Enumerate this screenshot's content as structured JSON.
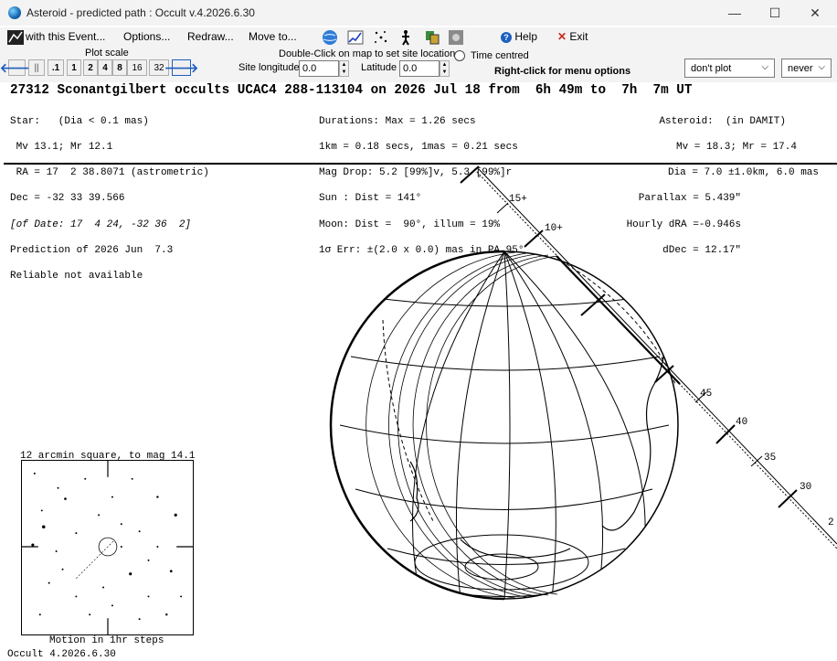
{
  "window": {
    "title": "Asteroid - predicted path : Occult v.4.2026.6.30",
    "minimize": "—",
    "maximize": "☐",
    "close": "✕"
  },
  "menu": {
    "with_event": "with this Event...",
    "options": "Options...",
    "redraw": "Redraw...",
    "move_to": "Move to...",
    "help": "Help",
    "exit": "Exit"
  },
  "toolbar": {
    "plot_scale_label": "Plot scale",
    "scales": [
      ".1",
      "1",
      "2",
      "4",
      "8",
      "16",
      "32"
    ],
    "pause": "||",
    "double_click_hint": "Double-Click on map to set site location",
    "site_longitude_label": "Site longitude",
    "site_longitude_value": "0.0",
    "latitude_label": "Latitude",
    "latitude_value": "0.0",
    "time_centred_label": "Time centred",
    "right_click_hint": "Right-click for menu options",
    "plot_select": "don't plot",
    "never_select": "never"
  },
  "event": {
    "headline": "27312 Sconantgilbert occults UCAC4 288-113104 on 2026 Jul 18 from  6h 49m to  7h  7m UT",
    "col1": [
      "Star:   (Dia < 0.1 mas)",
      " Mv 13.1; Mr 12.1",
      " RA = 17  2 38.8071 (astrometric)",
      "Dec = -32 33 39.566",
      "[of Date: 17  4 24, -32 36  2]",
      "Prediction of 2026 Jun  7.3",
      "Reliable not available"
    ],
    "col2": [
      "Durations: Max = 1.26 secs",
      "1km = 0.18 secs, 1mas = 0.21 secs",
      "Mag Drop: 5.2 [99%]v, 5.3 [99%]r",
      "Sun : Dist = 141°",
      "Moon: Dist =  90°, illum = 19%",
      "1σ Err: ±(2.0 x 0.0) mas in PA 95°"
    ],
    "col3": [
      "Asteroid:  (in DAMIT)",
      "Mv = 18.3; Mr = 17.4",
      "Dia = 7.0 ±1.0km, 6.0 mas",
      "Parallax = 5.439\"",
      "Hourly dRA =-0.946s",
      "dDec = 12.17\""
    ],
    "path_ticks": [
      "15+",
      "10+",
      "45",
      "40",
      "35",
      "30",
      "2"
    ]
  },
  "finder": {
    "title": "12 arcmin square, to mag 14.1",
    "caption": "Motion in 1hr steps"
  },
  "footer": "Occult 4.2026.6.30",
  "colors": {
    "chrome": "#f3f3f3",
    "arrow_blue": "#1d5fbf",
    "exit_red": "#c42b1c"
  }
}
